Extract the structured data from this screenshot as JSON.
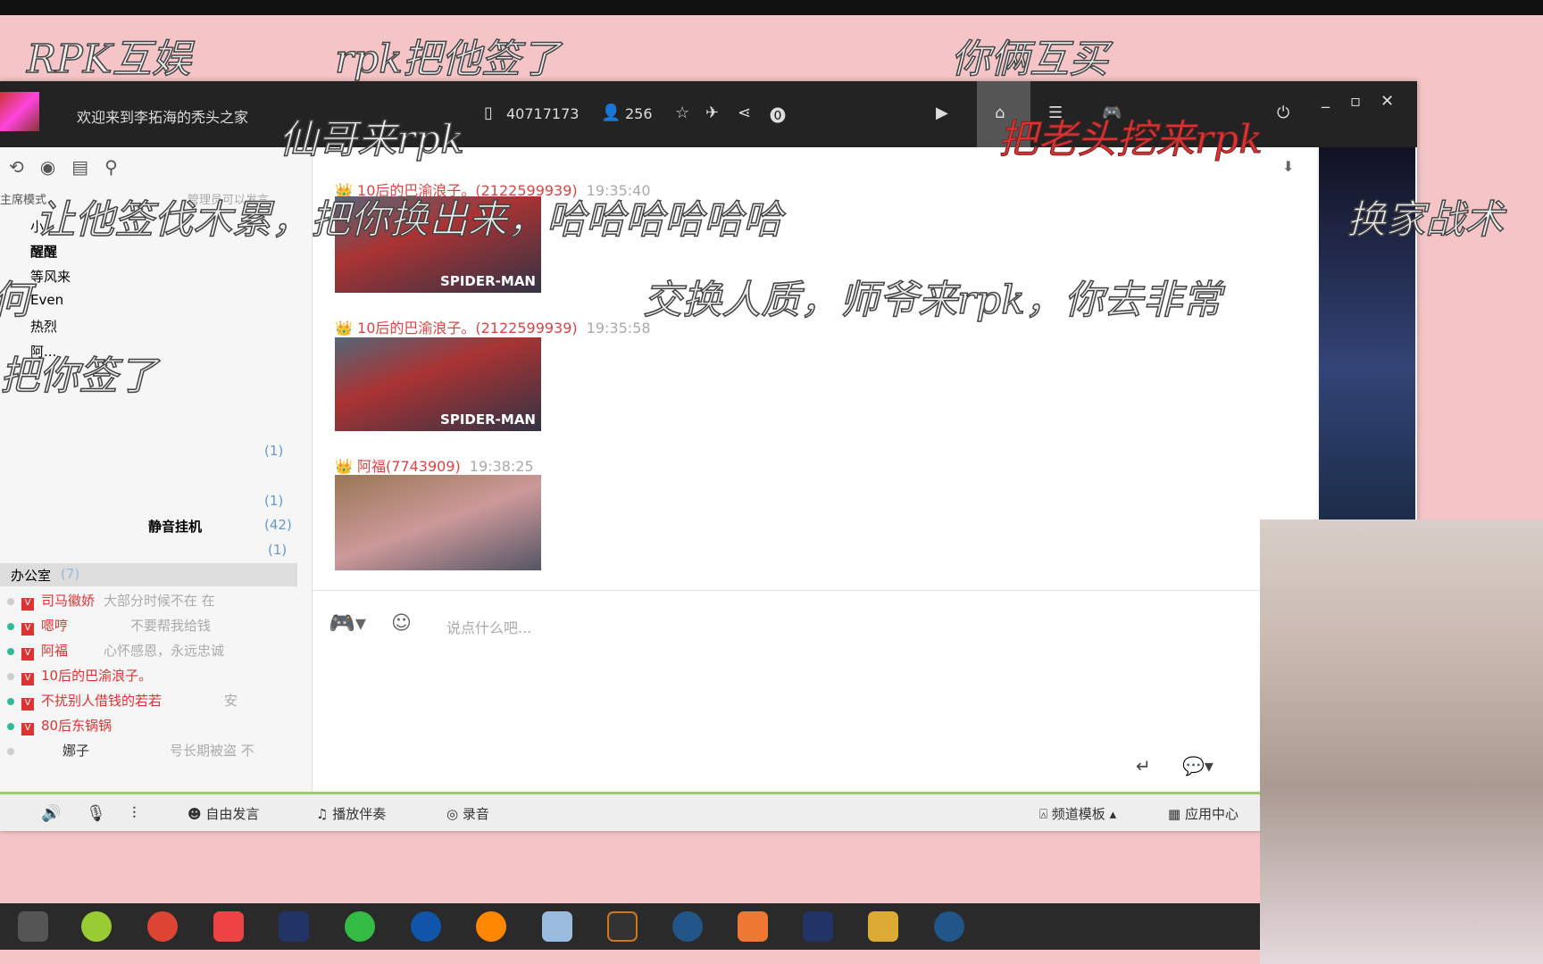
{
  "window": {
    "title": "欢迎来到李拓海的秃头之家",
    "room_id": "40717173",
    "online": "256"
  },
  "left_panel": {
    "mode": "主席模式",
    "mode_hint": "管理员可以发言",
    "channels": [
      "小",
      "醒醒",
      "等风来",
      "Even",
      "热烈",
      "阿..."
    ],
    "sub_channel": {
      "label": "静音挂机",
      "count": "(42)"
    },
    "counts": [
      "(1)",
      "(1)",
      "(1)"
    ],
    "office": {
      "label": "办公室",
      "count": "(7)"
    },
    "users": [
      {
        "name": "司马徽娇",
        "sign": "大部分时候不在 在",
        "online": false
      },
      {
        "name": "嗯哼",
        "sign": "不要帮我给钱",
        "online": true
      },
      {
        "name": "阿福",
        "sign": "心怀感恩，永远忠诚",
        "online": true
      },
      {
        "name": "10后的巴渝浪子。",
        "sign": "",
        "online": false
      },
      {
        "name": "不扰别人借钱的若若",
        "sign": "安",
        "online": true
      },
      {
        "name": "80后东锅锅",
        "sign": "",
        "online": true
      },
      {
        "name": "娜子",
        "sign": "号长期被盗 不",
        "online": false
      }
    ]
  },
  "chat": {
    "messages": [
      {
        "name": "10后的巴渝浪子。(2122599939)",
        "time": "19:35:40",
        "image": "SPIDER-MAN"
      },
      {
        "name": "10后的巴渝浪子。(2122599939)",
        "time": "19:35:58",
        "image": "SPIDER-MAN"
      },
      {
        "name": "阿福(7743909)",
        "time": "19:38:25",
        "image": ""
      }
    ],
    "input_placeholder": "说点什么吧..."
  },
  "toolbar": {
    "free_speech": "自由发言",
    "play_music": "播放伴奏",
    "record": "录音",
    "channel_template": "频道模板",
    "app_center": "应用中心"
  },
  "danmaku": [
    "RPK互娱",
    "rpk把他签了",
    "你俩互买",
    "仙哥来rpk",
    "把老头挖来rpk",
    "让他签伐木累，把你换出来，哈哈哈哈哈哈",
    "换家战术",
    "交换人质，师爷来rpk，你去非常",
    "把你签了",
    "何"
  ]
}
